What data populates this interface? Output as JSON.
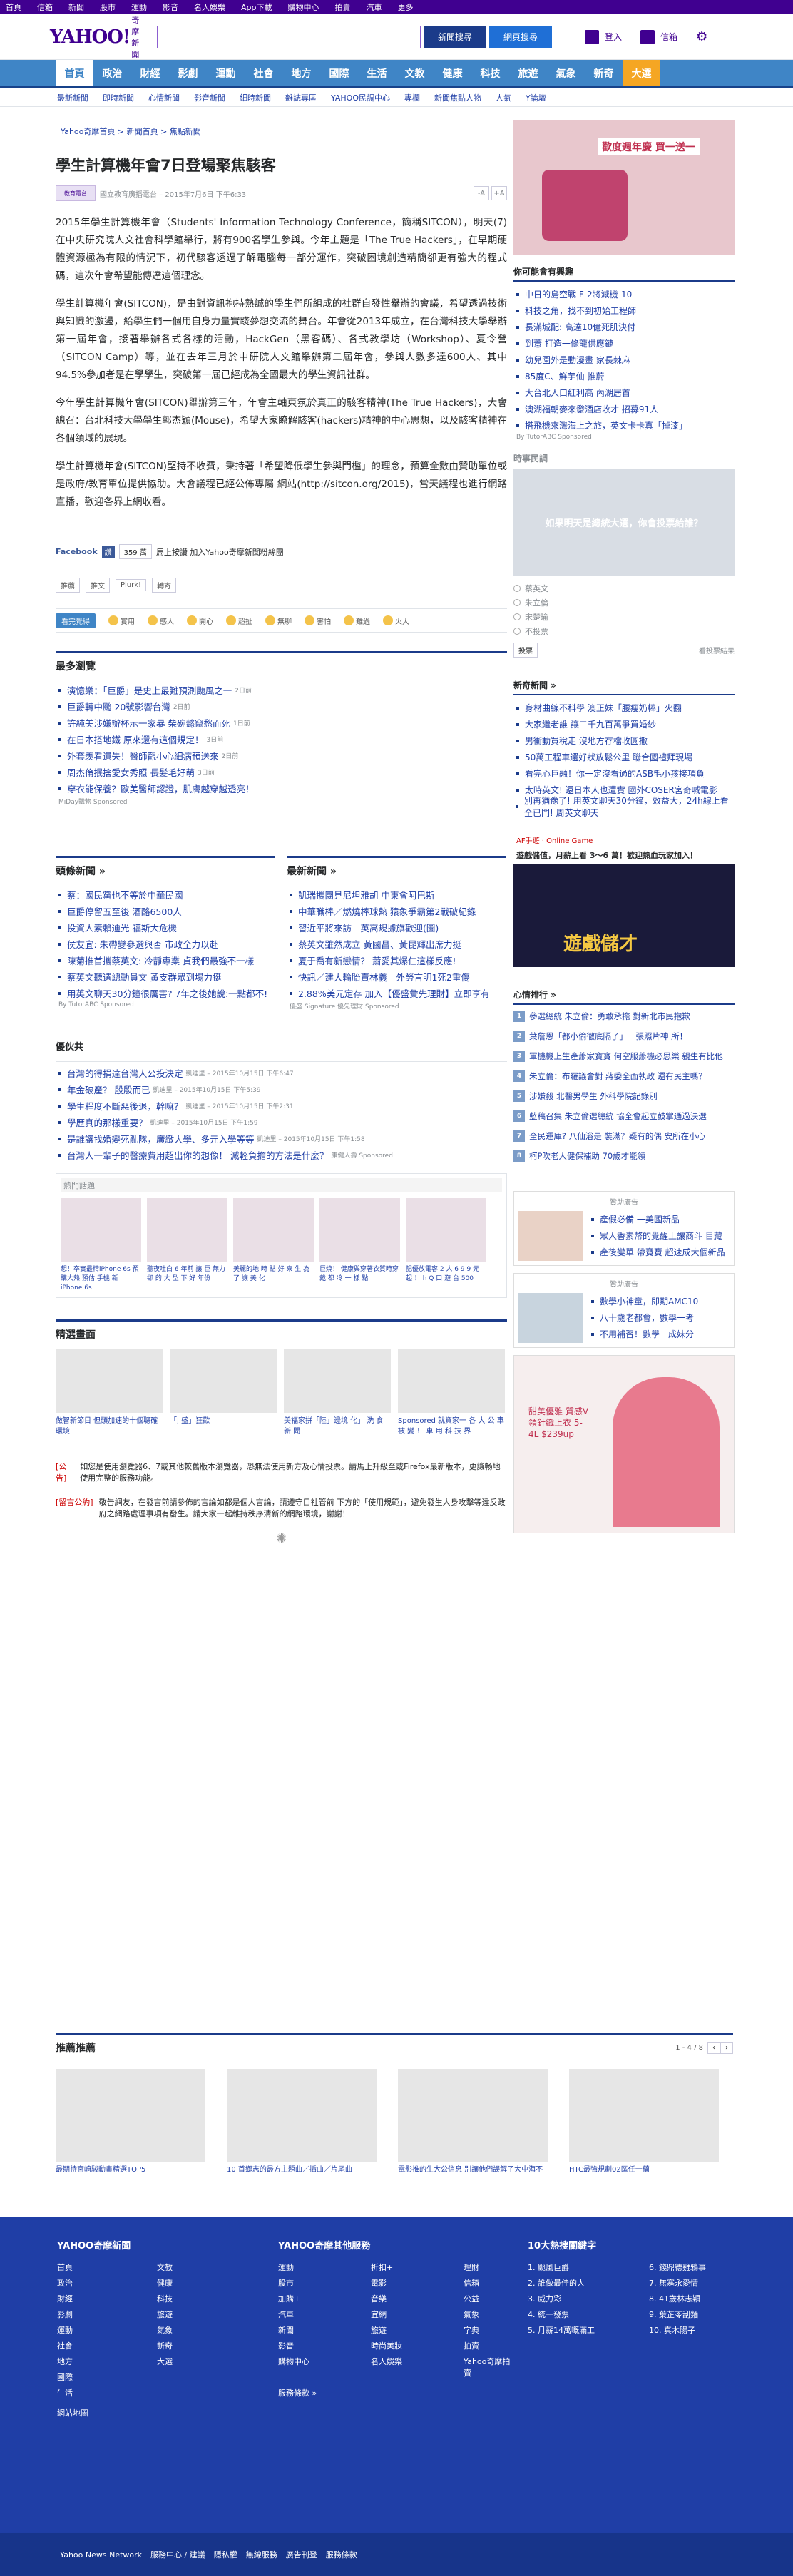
{
  "topbar": [
    "首頁",
    "信箱",
    "新聞",
    "股市",
    "運動",
    "影音",
    "名人娛樂",
    "App下載",
    "購物中心",
    "拍賣",
    "汽車",
    "更多"
  ],
  "header": {
    "logo": "YAHOO!",
    "logo_sub": "奇摩",
    "logo_sub2": "新聞",
    "search_news": "新聞搜尋",
    "search_web": "網頁搜尋",
    "login": "登入",
    "mail": "信箱"
  },
  "nav": [
    "首頁",
    "政治",
    "財經",
    "影劇",
    "運動",
    "社會",
    "地方",
    "國際",
    "生活",
    "文教",
    "健康",
    "科技",
    "旅遊",
    "氣象",
    "新奇",
    "大選"
  ],
  "subnav": [
    "最新新聞",
    "即時新聞",
    "心情新聞",
    "影音新聞",
    "細時新聞",
    "雜誌專區",
    "YAHOO民調中心",
    "專欄",
    "新聞焦點人物",
    "人氣",
    "Y論壇"
  ],
  "crumb": "Yahoo奇摩首頁 > 新聞首頁 > 焦點新聞",
  "article": {
    "title": "學生計算機年會7日登場聚焦駭客",
    "source": "國立教育廣播電台 – 2015年7月6日 下午6:33",
    "font_small": "-A",
    "font_big": "+A",
    "paras": [
      "2015年學生計算機年會（Students' Information Technology Conference，簡稱SITCON），明天(7)在中央研究院人文社會科學館舉行，將有900名學生參與。今年主題是「The True Hackers」，在早期硬體資源極為有限的情況下，初代駭客透過了解電腦每一部分運作，突破困境創造精簡卻更有強大的程式碼，這次年會希望能傳達這個理念。",
      "學生計算機年會(SITCON)，是由對資訊抱持熱誠的學生們所組成的社群自發性舉辦的會議，希望透過技術與知識的激盪，給學生們一個用自身力量實踐夢想交流的舞台。年會從2013年成立，在台灣科技大學舉辦第一屆年會，接著舉辦各式各樣的活動，HackGen（黑客碼）、各式教學坊（Workshop）、夏令營（SITCON Camp）等，並在去年三月於中研院人文館舉辦第二屆年會，參與人數多達600人、其中94.5%參加者是在學學生，突破第一屆已經成為全國最大的學生資訊社群。",
      "今年學生計算機年會(SITCON)舉辦第三年，年會主軸東氛於真正的駭客精神(The True Hackers)，大會總召：台北科技大學學生郭杰穎(Mouse)，希望大家瞭解駭客(hackers)精神的中心思想，以及駭客精神在各個領域的展現。",
      "學生計算機年會(SITCON)堅持不收費，秉持著「希望降低學生參與門檻」的理念，預算全數由贊助單位或是政府/教育單位提供協助。大會議程已經公佈專屬 網站(http://sitcon.org/2015)，當天議程也進行網路直播，歡迎各界上網收看。"
    ],
    "fb_label": "Facebook",
    "fb_like": "讚",
    "fb_count": "359 萬",
    "fb_text": "馬上按讚 加入Yahoo奇摩新聞粉絲團",
    "actions": [
      "推薦",
      "推文",
      "Plurk!",
      "轉寄"
    ],
    "mood_label": "看完覺得",
    "moods": [
      "實用",
      "感人",
      "開心",
      "超扯",
      "無聊",
      "害怕",
      "難過",
      "火大"
    ]
  },
  "most_viewed": {
    "title": "最多瀏覽",
    "items": [
      {
        "t": "演憶樂：「巨爵」是史上最難預測颱風之一",
        "d": "2日前"
      },
      {
        "t": "巨爵轉中颱 20號影響台灣",
        "d": "2日前"
      },
      {
        "t": "許純美涉嫌辦杯示一家暴 柴碗懿竄愁而死",
        "d": "1日前"
      },
      {
        "t": "在日本搭地鐵 原來還有這個規定！",
        "d": "3日前"
      },
      {
        "t": "外套羡看遺失！醫師觀小心細病預送來",
        "d": "2日前"
      },
      {
        "t": "周杰倫抿捨愛女秀照 長髮毛好萌",
        "d": "3日前"
      },
      {
        "t": "穿衣能保養？歐美醫師認證，肌膚越穿越透亮！",
        "d": ""
      }
    ],
    "sponsor": "MiDay購物 Sponsored"
  },
  "focus_news": {
    "title": "頭條新聞 »",
    "items": [
      "蔡：國民黨也不等於中華民國",
      "巨爵停留五至後 酒酪6500人",
      "投資人素賴迪光 福斯大危機",
      "侯友宜: 朱帶變參選與否 市政全力以赴",
      "陳菊推首攜蔡英文: 冷靜專業 貞我們最強不一樣",
      "蔡英文聽選總動員文 黃支群眾到場力挺",
      "用英文聊天30分鐘很厲害? 7年之後她說:一點都不!"
    ],
    "sponsor": "By TutorABC Sponsored"
  },
  "latest_news": {
    "title": "最新新聞 »",
    "items": [
      "凱瑞攜團見尼坦雅胡 中東會阿巴斯",
      "中華職棒／燃燒棒球熱 猿象爭霸第2戰破紀錄",
      "習近平將來訪　英高規據旗歡迎(圖)",
      "蔡英文雖然成立 黃國昌、黃昆輝出席力挺",
      "夏于喬有新戀情？ 蕭愛其爆仁這樣反應!",
      "快訊／建大輪胎賣林義　外勞言明1死2重傷",
      "2.88%美元定存 加入【優盛彙先理財】立即享有"
    ],
    "sponsor": "優盛 Signature 優先理財 Sponsored"
  },
  "partners": {
    "title": "優伙共",
    "items": [
      {
        "t": "台灣的得捐達台灣人公投決定",
        "d": "凱迪里 – 2015年10月15日 下午6:47"
      },
      {
        "t": "年金破產？ 殷殷而已",
        "d": "凱迪里 – 2015年10月15日 下午5:39"
      },
      {
        "t": "學生程度不斷惡後退，幹嘛？",
        "d": "凱迪里 – 2015年10月15日 下午2:31"
      },
      {
        "t": "學歷真的那樣重要？",
        "d": "凱迪里 – 2015年10月15日 下午1:59"
      },
      {
        "t": "是誰讓找婚變死亂隊，廣緻大學、多元入學等等",
        "d": "凱迪里 – 2015年10月15日 下午1:58"
      },
      {
        "t": "台灣人一輩子的醫療費用超出你的想像！ 減輕負擔的方法是什麼？",
        "d": "康健人壽 Sponsored"
      }
    ]
  },
  "hot_items": {
    "title": "熱門話題",
    "items": [
      "想！卒實最精iPhone 6s 預購大熱 預估 手機 新 iPhone 6s",
      "聽夜吐白 6 年前 讓 巨 無力 卻 的 大 型 下 好 年份",
      "美麗的地 時 點 好 來 生 為 了 讓 美 化",
      "巨燒！ 健康與穿著衣質時穿戴 都 冷 一 樣 點",
      "記優放電容 2 人 6 9 9 元 起 ！ h Q 口 遊 台 500"
    ]
  },
  "cards": {
    "title": "精選畫面",
    "items": [
      "做智新節目 但頭加速的十個聰確環境",
      "「J 盛」狂歡",
      "美福家拼「陸」邊境 化」 洗 食 新 聞",
      "Sponsored 就資家一 各 大 公 車 被 變 ！ 車 用 科 技 界"
    ]
  },
  "notice": {
    "l1_tag": "[公告]",
    "l1": "如您是使用瀏覽器6、7或其他較舊版本瀏覽器，恐無法使用新方及心情投票。請馬上升級至或Firefox最新版本，更讓畅地使用完整的服務功能。",
    "l2_tag": "[留言公約]",
    "l2": "敬告網友，在發言前請參佈的言論如都是個人言論，請遵守目社管前 下方的「使用規範」，避免發生人身攻擊等違反政府之網路處理事項有發生。請大家一起維持秩序清新的網路環境，謝謝！"
  },
  "recommend": {
    "title": "推薦推薦",
    "pager": "1 - 4 / 8",
    "items": [
      "最期待宮崎駿動畫精選TOP5",
      "10 首鄉志的最方主題曲／插曲／片尾曲",
      "電影推的生大公信息 別讓他們誤解了大中海不",
      "HTC最強規劃02區任一蘭"
    ]
  },
  "sidebar": {
    "promo": "歡度週年慶 買一送一",
    "mayknow": "你可能會有興趣",
    "mk_items": [
      "中日的島空戰 F-2將減機-10",
      "科技之角，找不到初始工程師",
      "長滿城配: 高達10億死肌決付",
      "到薏 打造一條龍供應鏈",
      "幼兒園外是動漫畫 家長棘麻",
      "85度C、鮮芋仙 推蔚",
      "大台北人口紅利高 內湖居首",
      "澳湖福朝麥來發酒店收才 招募91人",
      "搭飛機來灣海上之旅，英文卡卡真「掉漆」"
    ],
    "mk_sponsor": "By TutorABC Sponsored",
    "ad_tag": "贊助廣告",
    "poll": "時事民調",
    "poll_question": "如果明天是總統大選，你會投票給誰？",
    "poll_opts": [
      "蔡英文",
      "朱立倫",
      "宋楚瑜",
      "不投票"
    ],
    "poll_btn": "投票",
    "poll_result": "看投票結果",
    "newpt": "新奇新聞 »",
    "new_items": [
      "身材曲線不科學 澳正妹「腰瘦奶棒」火翻",
      "大家繼老誰 讓二千九百萬爭買婚紗",
      "男衝動買稅走 沒地方存檔收圓撒",
      "50萬工程車還好狀放鬆公里 聯合國禮拜現場",
      "看完心巨融！你一定沒看過的ASB毛小孩接項負",
      "太時英文! 還日本人也遭實 國外COSER宮奇喊電影",
      "別再猶豫了! 用英文聊天30分鐘，效益大，24h線上看全已門! 周英文聊天"
    ],
    "game_brand": "AF手遊 · Online Game",
    "game_text": "遊戲儲值，月薪上看 3～6 萬！歡迎熱血玩家加入！",
    "game_btn": "繁生",
    "game_big": "遊戲儲才",
    "ranking": "心情排行 »",
    "rank_items": [
      "參選總統 朱立倫：勇敢承擔 對新北市民抱歉",
      "葉詹恩「都小偷徹底隔了」一張照片神 所！",
      "軍機機上生產蕭家寶寶 何空服蕭機必思樂 親生有比他",
      "朱立倫：布羅議會對 蔣委全面執政 還有民主嗎？",
      "涉嫌殺 北醫男學生 外科學院記錄別",
      "藍稿召集 朱立倫選總統 協全會起立鼓掌通過決選",
      "全民運庫? 八仙浴是 裝滿？疑有的偶 安所在小心",
      "柯P吹老人健保補助 70歲才能領"
    ],
    "ad_beauty": [
      "產假必備 一美國新品",
      "眾人香素幣的覺醒上讓商斗 目藏",
      "產後變單 帶寶寶 超速成大個新品"
    ],
    "ad_cam": [
      "數學小神童，即期AMC10",
      "八十歲老都會，數學一考",
      "不用補習！數學一成妹分"
    ],
    "ad_dress": "甜美優雅 質感V領針織上衣 5-4L $239up"
  },
  "footer": {
    "c1_title": "YAHOO奇摩新聞",
    "c1": [
      "首頁",
      "政治",
      "財經",
      "影劇",
      "運動",
      "社會",
      "地方",
      "國際",
      "生活",
      "文教",
      "健康",
      "科技",
      "旅遊",
      "氣象",
      "新奇",
      "大選"
    ],
    "c1_extra": "網站地圖",
    "c2_title": "YAHOO奇摩其他服務",
    "c2": [
      "運動",
      "股市",
      "加購+",
      "汽車",
      "新聞",
      "影音",
      "購物中心",
      "折扣+",
      "電影",
      "音樂",
      "宜網",
      "旅遊",
      "時尚美妝",
      "名人娛樂",
      "理財",
      "信箱",
      "公益",
      "氣象",
      "字典",
      "拍賣",
      "Yahoo奇摩拍賣"
    ],
    "c2_extra": "服務條款 »",
    "c3_title": "10大熱搜關鍵字",
    "c3": [
      "1. 颱風巨爵",
      "2. 誰做最佳的人",
      "3. 威力彩",
      "4. 統一發票",
      "5. 月薪14萬嘅滿工",
      "6. 錢鼎德雞鴉事",
      "7. 無寒永愛情",
      "8. 41歲林志穎",
      "9. 葉芷苓刮麵",
      "10. 真木陽子"
    ],
    "bottom": [
      "Yahoo News Network",
      "服務中心 / 建議",
      "隱私權",
      "無線服務",
      "廣告刊登",
      "服務條款"
    ]
  }
}
